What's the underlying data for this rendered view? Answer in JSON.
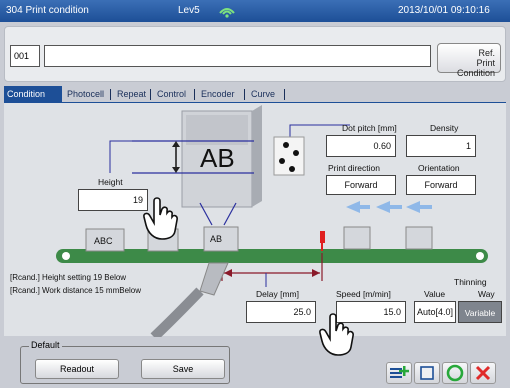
{
  "titlebar": {
    "title": "304 Print condition",
    "level": "Lev5",
    "datetime": "2013/10/01 09:10:16"
  },
  "header": {
    "message_number": "001",
    "message_name": "",
    "ref_button_line1": "Ref.",
    "ref_button_line2": "Print Condition"
  },
  "tabs": [
    "Condition",
    "Photocell",
    "Repeat",
    "Control",
    "Encoder",
    "Curve"
  ],
  "active_tab": "Condition",
  "panel": {
    "sample_text": "AB",
    "conveyor_items": [
      "ABC",
      "AB"
    ],
    "height": {
      "label": "Height",
      "value": "19"
    },
    "dot_pitch": {
      "label": "Dot pitch [mm]",
      "value": "0.60"
    },
    "density": {
      "label": "Density",
      "value": "1"
    },
    "print_direction": {
      "label": "Print direction",
      "value": "Forward"
    },
    "orientation": {
      "label": "Orientation",
      "value": "Forward"
    },
    "delay": {
      "label": "Delay [mm]",
      "value": "25.0"
    },
    "speed": {
      "label": "Speed [m/min]",
      "value": "15.0"
    },
    "thinning": {
      "label": "Thinning",
      "value_label": "Value",
      "way_label": "Way",
      "value": "Auto[4.0]",
      "way": "Variable"
    },
    "notes": [
      "[Rcand.] Height setting 19 Below",
      "[Rcand.] Work distance 15 mmBelow"
    ]
  },
  "default_group": {
    "title": "Default",
    "readout_label": "Readout",
    "save_label": "Save"
  },
  "colors": {
    "titlebar": "#1d4f97",
    "conveyor": "#3d8a48",
    "arrow": "#8fb8e8",
    "ok_icon": "#27a83a",
    "cancel_icon": "#e02a2a"
  }
}
